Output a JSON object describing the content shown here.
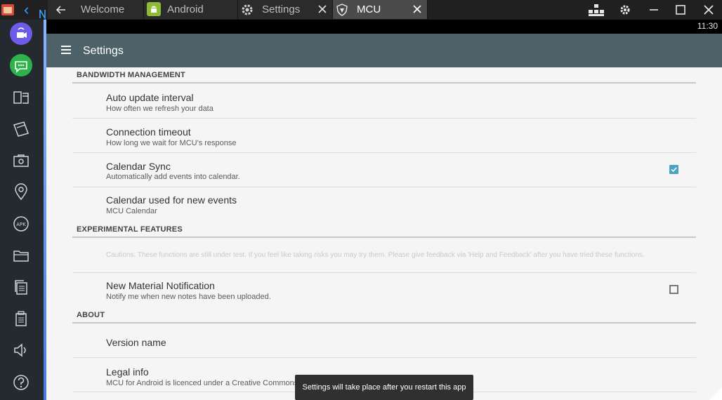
{
  "tabs": [
    {
      "label": "Welcome",
      "icon": "back-arrow-icon",
      "active": false
    },
    {
      "label": "Android",
      "icon": "android-icon",
      "active": false
    },
    {
      "label": "Settings",
      "icon": "gear-icon",
      "active": false
    },
    {
      "label": "MCU",
      "icon": "shield-icon",
      "active": true
    }
  ],
  "status_bar": {
    "time": "11:30"
  },
  "app_bar": {
    "title": "Settings"
  },
  "sections": [
    {
      "header": "BANDWIDTH MANAGEMENT",
      "items": [
        {
          "title": "Auto update interval",
          "summary": "How often we refresh your data"
        },
        {
          "title": "Connection timeout",
          "summary": "How long we wait for MCU's response"
        },
        {
          "title": "Calendar Sync",
          "summary": "Automatically add events into calendar.",
          "checked": true
        },
        {
          "title": "Calendar used for new events",
          "summary": "MCU Calendar"
        }
      ]
    },
    {
      "header": "EXPERIMENTAL FEATURES",
      "caution": "Cautions: These functions are still under test. If you feel like taking risks you may try them. Please give feedback via 'Help and Feedback' after you have tried these functions.",
      "items": [
        {
          "title": "New Material Notification",
          "summary": "Notify me when new notes have been uploaded.",
          "checked": false
        }
      ]
    },
    {
      "header": "ABOUT",
      "items": [
        {
          "title": "Version name"
        },
        {
          "title": "Legal info",
          "summary": "MCU for Android is licenced under a Creative Commons Att"
        }
      ]
    }
  ],
  "toast": "Settings will take place after you restart this app",
  "colors": {
    "app_bar": "#4c6268",
    "checkbox_accent": "#4aa3c3",
    "dock": "#252930",
    "background": "#f5f5f5"
  }
}
